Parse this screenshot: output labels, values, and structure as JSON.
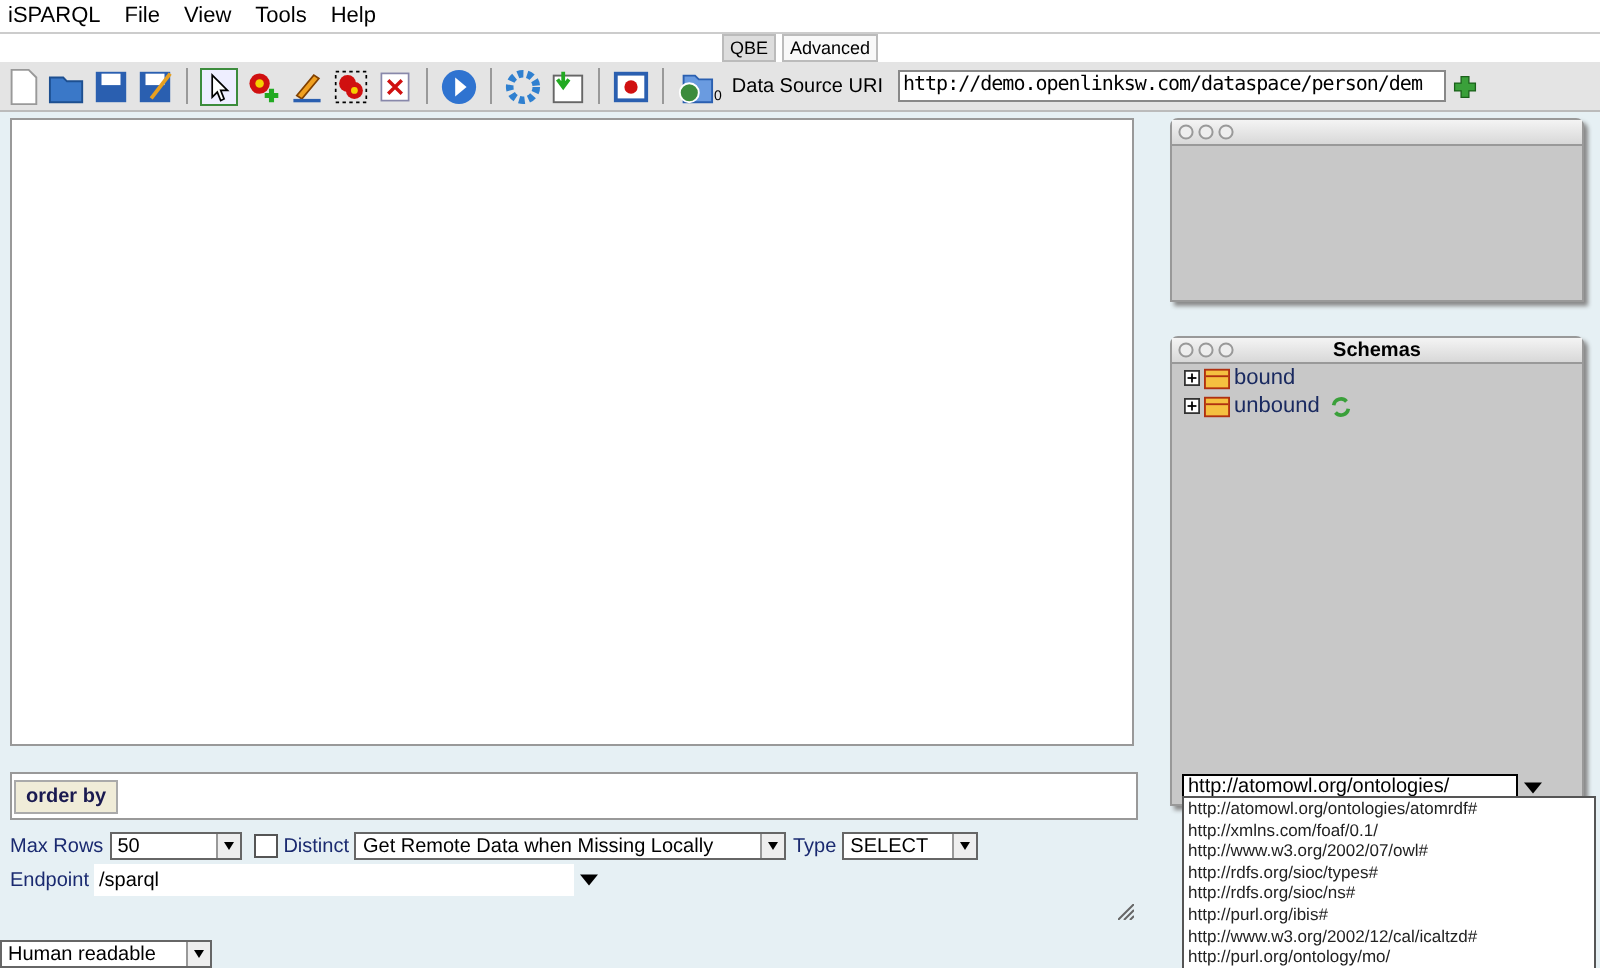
{
  "menu": [
    "iSPARQL",
    "File",
    "View",
    "Tools",
    "Help"
  ],
  "tabs": [
    {
      "label": "QBE",
      "selected": true
    },
    {
      "label": "Advanced",
      "selected": false
    }
  ],
  "toolbar": {
    "tools": [
      {
        "kind": "pointer",
        "selected": true
      },
      {
        "kind": "add-node",
        "selected": false
      },
      {
        "kind": "pencil",
        "selected": false
      },
      {
        "kind": "group",
        "selected": false
      },
      {
        "kind": "delete",
        "selected": false
      }
    ],
    "source_count": "0",
    "source_label": "Data Source URI",
    "source_value": "http://demo.openlinksw.com/dataspace/person/dem"
  },
  "order_by": {
    "label": "order by"
  },
  "options": {
    "max_rows_label": "Max Rows",
    "max_rows": "50",
    "distinct_label": "Distinct",
    "distinct_checked": false,
    "remote": "Get Remote Data when Missing Locally",
    "type_label": "Type",
    "type": "SELECT",
    "endpoint_label": "Endpoint",
    "endpoint": "/sparql"
  },
  "format": "Human readable",
  "schemas": {
    "title": "Schemas",
    "items": [
      {
        "label": "bound",
        "expanded": false,
        "refresh": false
      },
      {
        "label": "unbound",
        "expanded": false,
        "refresh": true
      }
    ],
    "combo_value": "http://atomowl.org/ontologies/",
    "options": [
      "http://atomowl.org/ontologies/atomrdf#",
      "http://xmlns.com/foaf/0.1/",
      "http://www.w3.org/2002/07/owl#",
      "http://rdfs.org/sioc/types#",
      "http://rdfs.org/sioc/ns#",
      "http://purl.org/ibis#",
      "http://www.w3.org/2002/12/cal/icaltzd#",
      "http://purl.org/ontology/mo/"
    ]
  }
}
